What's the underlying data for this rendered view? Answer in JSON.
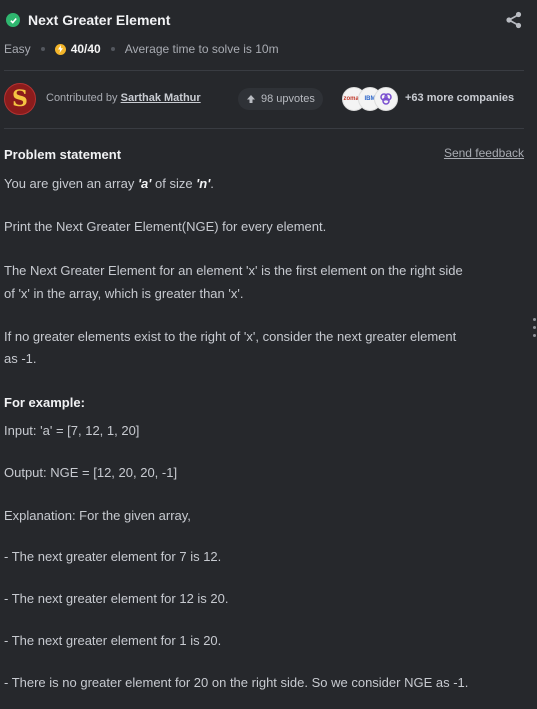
{
  "problem": {
    "title": "Next Greater Element",
    "difficulty": "Easy",
    "score": "40/40",
    "average_time": "Average time to solve is 10m"
  },
  "contributor": {
    "prefix": "Contributed by ",
    "name": "Sarthak Mathur",
    "avatar_letter": "S",
    "upvotes": "98 upvotes",
    "more_companies": "+63 more companies",
    "company_logos": [
      "zomato",
      "ibm",
      "hashedin"
    ]
  },
  "statement": {
    "header": "Problem statement",
    "feedback": "Send feedback",
    "line1_pre": "You are given an array ",
    "line1_a": "'a'",
    "line1_mid": " of size ",
    "line1_n": "'n'",
    "line1_post": ".",
    "p2": "Print the Next Greater Element(NGE) for every element.",
    "p3a": "The Next Greater Element for an element 'x' is the first element on the right side",
    "p3b": "of 'x' in the array, which is greater than 'x'.",
    "p4a": "If no greater elements exist to the right of 'x', consider the next greater element",
    "p4b": "as -1.",
    "example_header": "For example:",
    "input": "Input: 'a' = [7, 12, 1, 20]",
    "output": "Output: NGE = [12, 20, 20, -1]",
    "explanation": "Explanation: For the given array,",
    "e1": "- The next greater element for 7 is 12.",
    "e2": "- The next greater element for 12 is 20.",
    "e3": "- The next greater element for 1 is 20.",
    "e4": "- There is no greater element for 20 on the right side. So we consider NGE as -1."
  },
  "colors": {
    "background": "#26282c",
    "check": "#2fb66f",
    "coin": "#f3b52a",
    "avatar": "#8c1c1c"
  }
}
